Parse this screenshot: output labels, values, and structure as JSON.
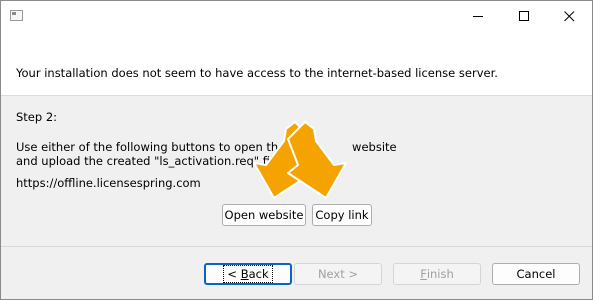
{
  "window": {
    "header_message": "Your installation does not seem to have access to the internet-based license server."
  },
  "body": {
    "step_title": "Step 2:",
    "line1_before": "Use either of the following buttons to open the fo",
    "line1_after": "website",
    "line2_before": "and upload the created \"ls_activation.req\" file th",
    "line3": "https://offline.licensespring.com"
  },
  "actions": {
    "open_website_label": "Open website",
    "copy_link_label": "Copy link"
  },
  "navigation": {
    "back_prefix": "< ",
    "back_accel": "B",
    "back_rest": "ack",
    "next_label": "Next >",
    "finish_accel": "F",
    "finish_rest": "inish",
    "cancel_label": "Cancel"
  },
  "colors": {
    "arrow_fill": "#f5a300",
    "arrow_outline": "#ffffff",
    "focus_border": "#0a64c8"
  },
  "icons": {
    "title_app": "window-app-icon",
    "minimize": "minimize-icon",
    "maximize": "maximize-icon",
    "close": "close-icon",
    "overlay": "orange-double-arrow-icon"
  }
}
